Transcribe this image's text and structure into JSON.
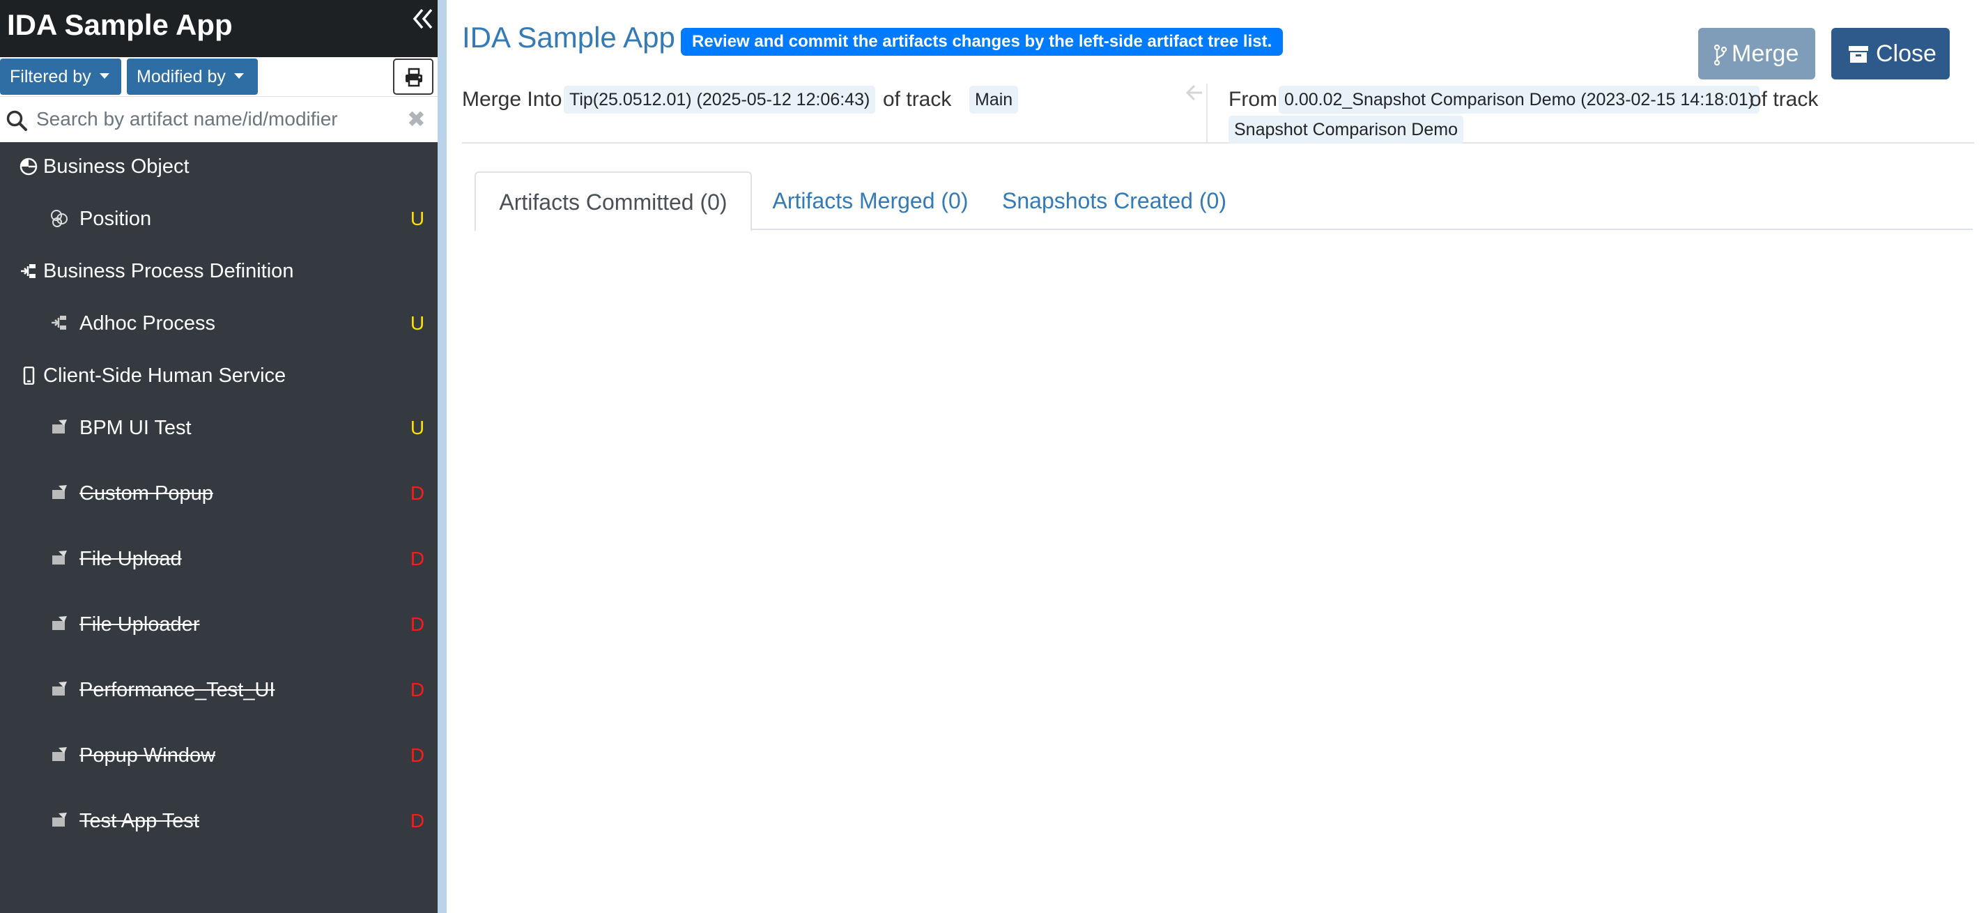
{
  "sidebar": {
    "title": "IDA Sample App",
    "filters": {
      "filtered_by": "Filtered by",
      "modified_by": "Modified by"
    },
    "search": {
      "placeholder": "Search by artifact name/id/modifier",
      "clear_glyph": "✖"
    },
    "groups": [
      {
        "label": "Business Object",
        "icon": "business-object-icon",
        "items": [
          {
            "label": "Position",
            "badge": "U",
            "icon": "business-object-item-icon"
          }
        ]
      },
      {
        "label": "Business Process Definition",
        "icon": "process-icon",
        "items": [
          {
            "label": "Adhoc Process",
            "badge": "U",
            "icon": "process-item-icon"
          }
        ]
      },
      {
        "label": "Client-Side Human Service",
        "icon": "mobile-icon",
        "items": [
          {
            "label": "BPM UI Test",
            "badge": "U",
            "icon": "human-service-icon"
          },
          {
            "label": "Custom Popup",
            "badge": "D",
            "icon": "human-service-icon"
          },
          {
            "label": "File Upload",
            "badge": "D",
            "icon": "human-service-icon"
          },
          {
            "label": "File Uploader",
            "badge": "D",
            "icon": "human-service-icon"
          },
          {
            "label": "Performance_Test_UI",
            "badge": "D",
            "icon": "human-service-icon"
          },
          {
            "label": "Popup Window",
            "badge": "D",
            "icon": "human-service-icon"
          },
          {
            "label": "Test App Test",
            "badge": "D",
            "icon": "human-service-icon"
          }
        ]
      }
    ]
  },
  "main": {
    "title": "IDA Sample App",
    "hint": "Review and commit the artifacts changes by the left-side artifact tree list.",
    "buttons": {
      "merge": "Merge",
      "close": "Close"
    },
    "merge_into": {
      "label": "Merge Into",
      "snapshot": "Tip(25.0512.01) (2025-05-12 12:06:43)",
      "of_track": "of track",
      "track": "Main"
    },
    "from": {
      "label": "From",
      "snapshot": "0.00.02_Snapshot Comparison Demo (2023-02-15 14:18:01)",
      "of_track": "of track",
      "track": "Snapshot Comparison Demo"
    },
    "tabs": [
      {
        "label": "Artifacts Committed (0)",
        "active": true
      },
      {
        "label": "Artifacts Merged (0)",
        "active": false
      },
      {
        "label": "Snapshots Created (0)",
        "active": false
      }
    ]
  },
  "colors": {
    "sidebar_bg": "#343a40",
    "header_bg": "#1d2124",
    "accent_blue": "#337ab7",
    "hint_badge": "#007bff",
    "badge_updated": "#ffe000",
    "badge_deleted": "#ff1a1a"
  }
}
